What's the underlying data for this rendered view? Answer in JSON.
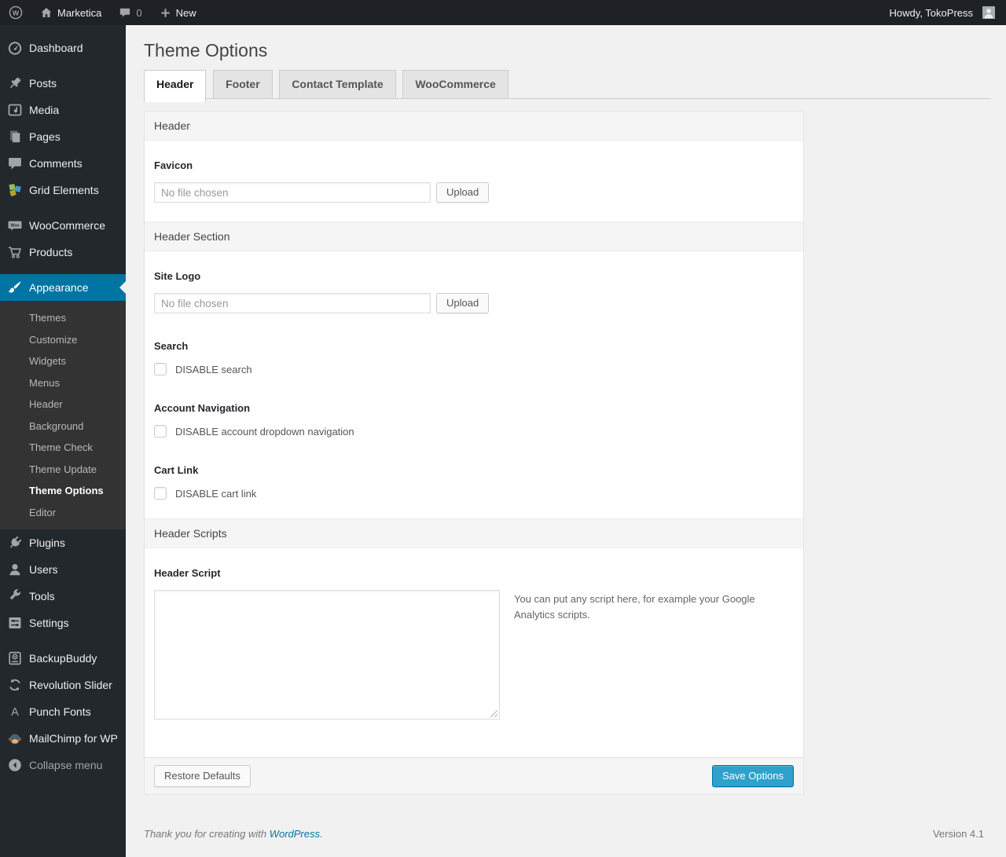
{
  "colors": {
    "accent": "#0074a2",
    "primary_button": "#2ea2cc",
    "menu_bg": "#23282d",
    "submenu_bg": "#333333",
    "content_bg": "#f1f1f1"
  },
  "admin_bar": {
    "site_name": "Marketica",
    "comments_count": "0",
    "new_label": "New",
    "howdy": "Howdy, TokoPress"
  },
  "sidebar": {
    "items": [
      {
        "label": "Dashboard"
      },
      {
        "label": "Posts"
      },
      {
        "label": "Media"
      },
      {
        "label": "Pages"
      },
      {
        "label": "Comments"
      },
      {
        "label": "Grid Elements"
      },
      {
        "label": "WooCommerce"
      },
      {
        "label": "Products"
      },
      {
        "label": "Appearance",
        "active": true
      },
      {
        "label": "Plugins"
      },
      {
        "label": "Users"
      },
      {
        "label": "Tools"
      },
      {
        "label": "Settings"
      },
      {
        "label": "BackupBuddy"
      },
      {
        "label": "Revolution Slider"
      },
      {
        "label": "Punch Fonts"
      },
      {
        "label": "MailChimp for WP"
      },
      {
        "label": "Collapse menu"
      }
    ],
    "appearance_submenu": [
      {
        "label": "Themes",
        "current": false
      },
      {
        "label": "Customize",
        "current": false
      },
      {
        "label": "Widgets",
        "current": false
      },
      {
        "label": "Menus",
        "current": false
      },
      {
        "label": "Header",
        "current": false
      },
      {
        "label": "Background",
        "current": false
      },
      {
        "label": "Theme Check",
        "current": false
      },
      {
        "label": "Theme Update",
        "current": false
      },
      {
        "label": "Theme Options",
        "current": true
      },
      {
        "label": "Editor",
        "current": false
      }
    ]
  },
  "page": {
    "title": "Theme Options",
    "tabs": [
      {
        "label": "Header",
        "active": true
      },
      {
        "label": "Footer",
        "active": false
      },
      {
        "label": "Contact Template",
        "active": false
      },
      {
        "label": "WooCommerce",
        "active": false
      }
    ]
  },
  "panel": {
    "sections": {
      "header": {
        "title": "Header"
      },
      "header_section": {
        "title": "Header Section"
      },
      "header_scripts": {
        "title": "Header Scripts"
      }
    },
    "favicon": {
      "label": "Favicon",
      "file_value": "",
      "placeholder": "No file chosen",
      "upload_label": "Upload"
    },
    "site_logo": {
      "label": "Site Logo",
      "file_value": "",
      "placeholder": "No file chosen",
      "upload_label": "Upload"
    },
    "search": {
      "label": "Search",
      "checkbox_label": "DISABLE search",
      "checked": false
    },
    "account_navigation": {
      "label": "Account Navigation",
      "checkbox_label": "DISABLE account dropdown navigation",
      "checked": false
    },
    "cart_link": {
      "label": "Cart Link",
      "checkbox_label": "DISABLE cart link",
      "checked": false
    },
    "header_script": {
      "label": "Header Script",
      "value": "",
      "hint": "You can put any script here, for example your Google Analytics scripts."
    },
    "footer_buttons": {
      "restore": "Restore Defaults",
      "save": "Save Options"
    }
  },
  "page_footer": {
    "thanks_prefix": "Thank you for creating with",
    "wordpress_link": "WordPress",
    "period": ".",
    "version": "Version 4.1"
  }
}
